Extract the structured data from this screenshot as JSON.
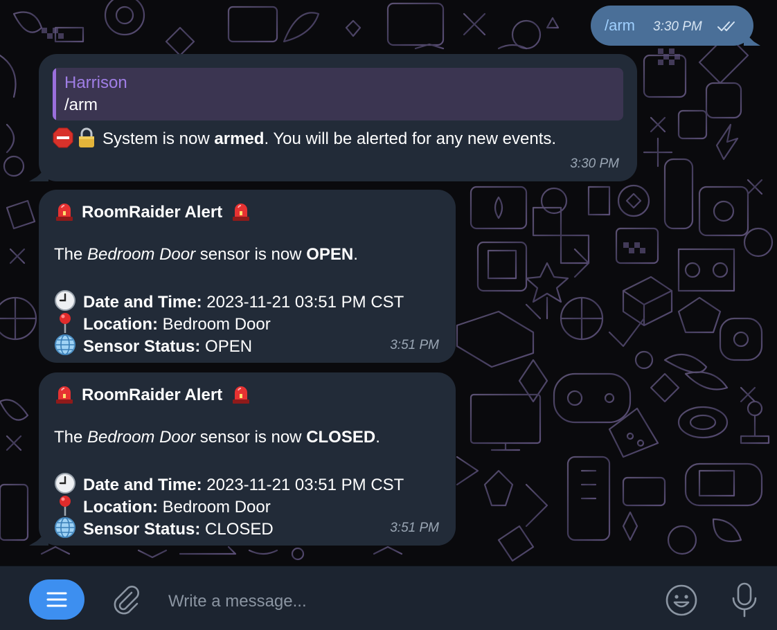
{
  "colors": {
    "bubble_in": "#222b38",
    "bubble_out": "#4a6f98",
    "quote_bg": "#3b3551",
    "quote_accent": "#9b6fdc",
    "accent_button": "#3d8ff0"
  },
  "outgoing": {
    "text": "/arm",
    "time": "3:30 PM",
    "status_icon": "double-check-icon"
  },
  "reply": {
    "quote_author": "Harrison",
    "quote_text": "/arm",
    "prefix": "System is now ",
    "bold": "armed",
    "suffix": ". You will be alerted for any new events.",
    "time": "3:30 PM",
    "icons": [
      "stop-sign-icon",
      "lock-icon"
    ]
  },
  "alerts": [
    {
      "title": "RoomRaider Alert",
      "body_prefix": "The ",
      "body_italic": "Bedroom Door",
      "body_middle": " sensor is now ",
      "body_bold": "OPEN",
      "body_suffix": ".",
      "date_label": "Date and Time:",
      "date_value": " 2023-11-21 03:51 PM CST",
      "location_label": "Location:",
      "location_value": " Bedroom Door",
      "status_label": "Sensor Status:",
      "status_value": " OPEN",
      "time": "3:51 PM"
    },
    {
      "title": "RoomRaider Alert",
      "body_prefix": "The ",
      "body_italic": "Bedroom Door",
      "body_middle": " sensor is now ",
      "body_bold": "CLOSED",
      "body_suffix": ".",
      "date_label": "Date and Time:",
      "date_value": " 2023-11-21 03:51 PM CST",
      "location_label": "Location:",
      "location_value": " Bedroom Door",
      "status_label": "Sensor Status:",
      "status_value": " CLOSED",
      "time": "3:51 PM"
    }
  ],
  "input": {
    "placeholder": "Write a message...",
    "icons": [
      "menu-icon",
      "paperclip-icon",
      "emoji-icon",
      "microphone-icon"
    ]
  }
}
